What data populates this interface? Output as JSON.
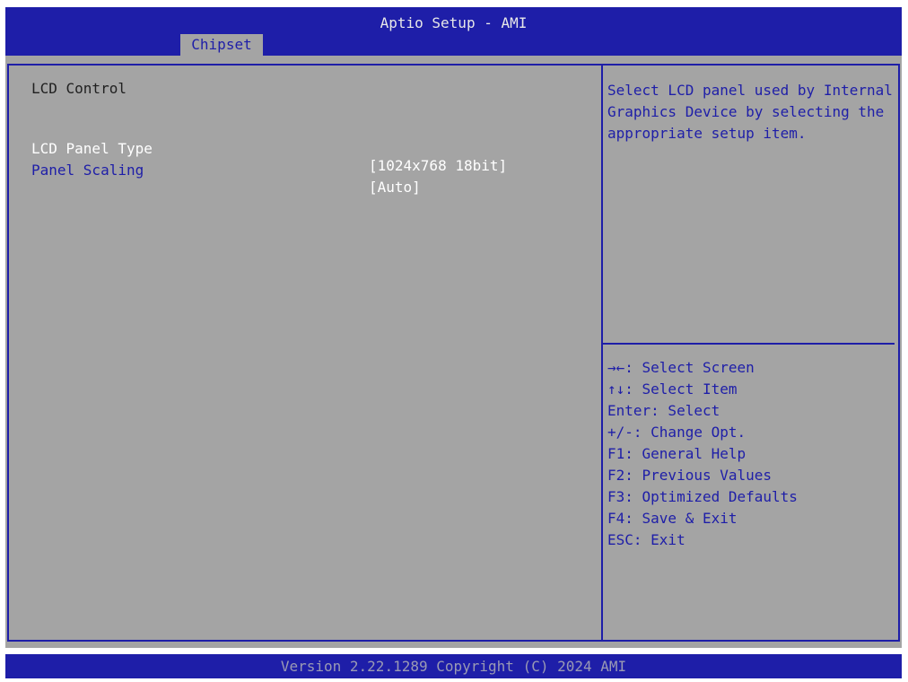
{
  "app_title": "Aptio Setup - AMI",
  "tabs": [
    {
      "label": "Chipset",
      "active": true
    }
  ],
  "main": {
    "section_title": "LCD Control",
    "items": [
      {
        "label": "LCD Panel Type",
        "value": "[1024x768 18bit]",
        "selected": true
      },
      {
        "label": "Panel Scaling",
        "value": "[Auto]",
        "selected": false
      }
    ]
  },
  "help": {
    "description": "Select LCD panel used by Internal Graphics Device by selecting the appropriate setup item.",
    "keys": [
      "→←: Select Screen",
      "↑↓: Select Item",
      "Enter: Select",
      "+/-: Change Opt.",
      "F1: General Help",
      "F2: Previous Values",
      "F3: Optimized Defaults",
      "F4: Save & Exit",
      "ESC: Exit"
    ]
  },
  "footer": "Version 2.22.1289 Copyright (C) 2024 AMI",
  "colors": {
    "bar_blue": "#1e1ea8",
    "panel_gray": "#a4a4a4",
    "selected_text": "#ffffff",
    "footer_text": "#9a9ab4"
  }
}
